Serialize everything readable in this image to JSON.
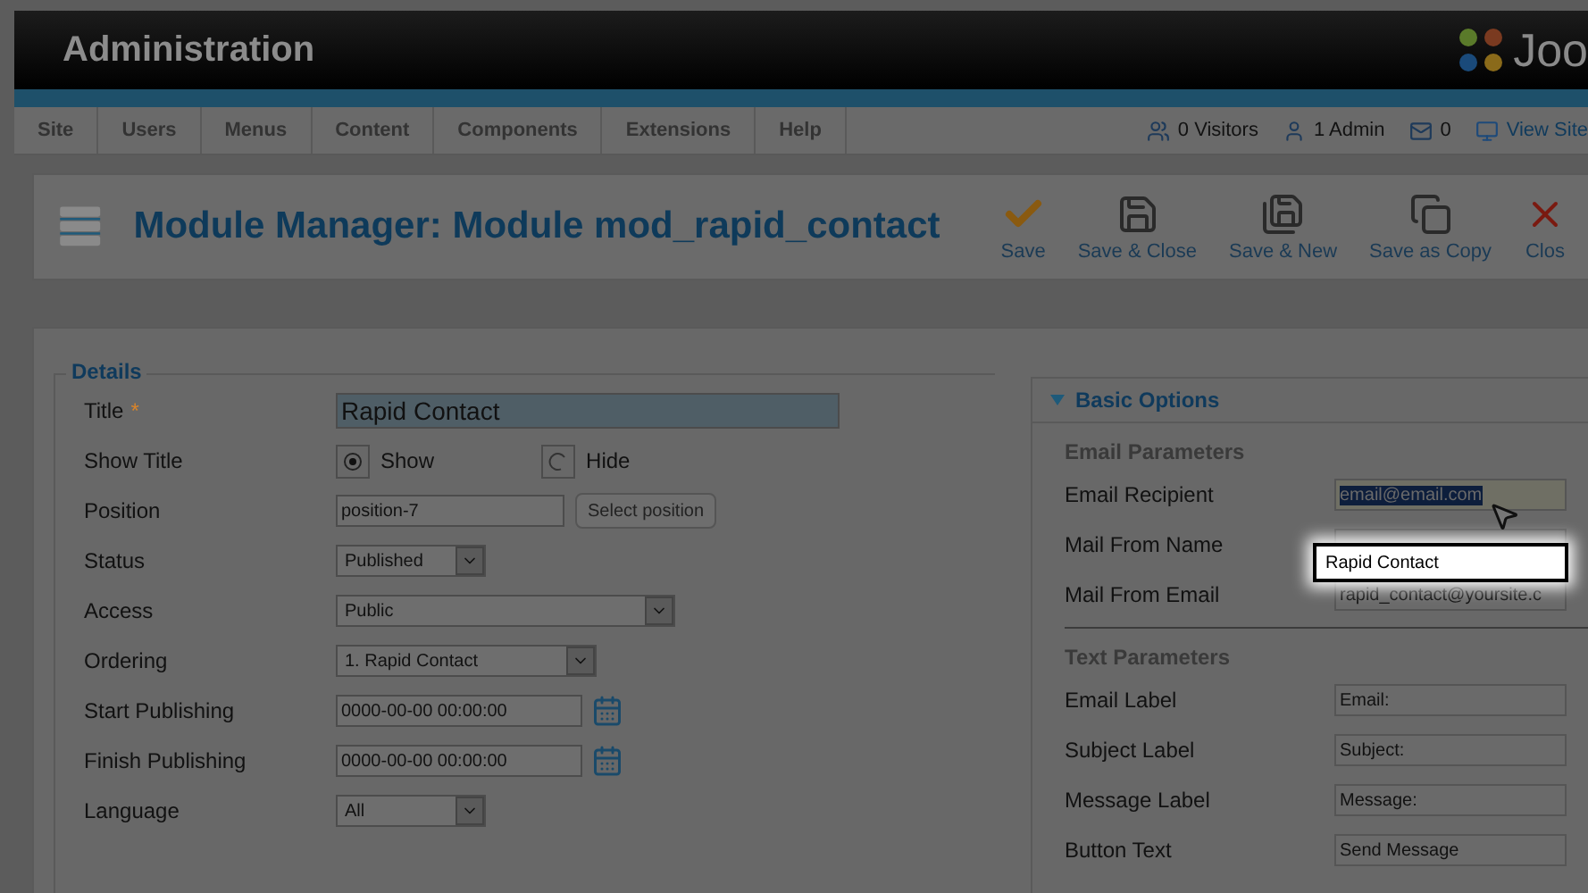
{
  "header": {
    "title": "Administration",
    "brand": "Joo"
  },
  "menu": [
    {
      "label": "Site"
    },
    {
      "label": "Users"
    },
    {
      "label": "Menus"
    },
    {
      "label": "Content"
    },
    {
      "label": "Components"
    },
    {
      "label": "Extensions"
    },
    {
      "label": "Help"
    }
  ],
  "status": [
    {
      "kind": "visitors",
      "label": "0 Visitors"
    },
    {
      "kind": "admin",
      "label": "1 Admin"
    },
    {
      "kind": "messages",
      "label": "0"
    },
    {
      "kind": "view",
      "label": "View Site"
    }
  ],
  "page_title": "Module Manager: Module mod_rapid_contact",
  "toolbar": [
    {
      "kind": "save",
      "label": "Save"
    },
    {
      "kind": "save-close",
      "label": "Save & Close"
    },
    {
      "kind": "save-new",
      "label": "Save & New"
    },
    {
      "kind": "save-copy",
      "label": "Save as Copy"
    },
    {
      "kind": "close",
      "label": "Clos"
    }
  ],
  "details": {
    "legend": "Details",
    "fields": [
      {
        "kind": "title",
        "label": "Title",
        "required": true,
        "mark": "*",
        "value": "Rapid Contact"
      },
      {
        "kind": "radio",
        "label": "Show Title",
        "options": [
          {
            "label": "Show",
            "selected": true
          },
          {
            "label": "Hide",
            "selected": false
          }
        ]
      },
      {
        "kind": "position",
        "label": "Position",
        "value": "position-7",
        "button": "Select position"
      },
      {
        "kind": "select-short",
        "label": "Status",
        "value": "Published"
      },
      {
        "kind": "select-long",
        "label": "Access",
        "value": "Public"
      },
      {
        "kind": "select-medium",
        "label": "Ordering",
        "value": "1. Rapid Contact"
      },
      {
        "kind": "date",
        "label": "Start Publishing",
        "value": "0000-00-00 00:00:00"
      },
      {
        "kind": "date",
        "label": "Finish Publishing",
        "value": "0000-00-00 00:00:00"
      },
      {
        "kind": "select-short",
        "label": "Language",
        "value": "All"
      }
    ]
  },
  "options": {
    "heading": "Basic Options",
    "expanded": true,
    "groups": [
      {
        "title": "Email Parameters",
        "fields": [
          {
            "label": "Email Recipient",
            "value": "email@email.com",
            "selected": true
          },
          {
            "label": "Mail From Name",
            "selected": false
          },
          {
            "label": "Mail From Email",
            "value": "rapid_contact@yoursite.c",
            "selected": false
          }
        ]
      },
      {
        "title": "Text Parameters",
        "fields": [
          {
            "label": "Email Label",
            "value": "Email:",
            "selected": false
          },
          {
            "label": "Subject Label",
            "value": "Subject:",
            "selected": false
          },
          {
            "label": "Message Label",
            "value": "Message:",
            "selected": false
          },
          {
            "label": "Button Text",
            "value": "Send Message",
            "selected": false
          }
        ]
      }
    ]
  },
  "callout": {
    "text": "Rapid Contact"
  }
}
